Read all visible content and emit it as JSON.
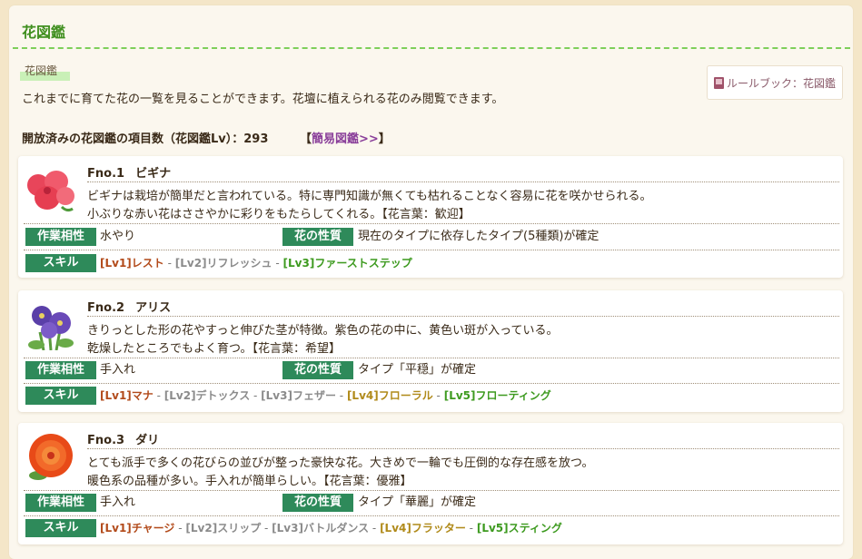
{
  "page": {
    "title": "花図鑑",
    "section_label": "花図鑑",
    "rulebook_label": "ルールブック：花図鑑",
    "description": "これまでに育てた花の一覧を見ることができます。花壇に植えられる花のみ閲覧できます。",
    "count_label": "開放済みの花図鑑の項目数（花図鑑Lv）：293",
    "quick_open": "【",
    "quick_link": "簡易図鑑>>",
    "quick_close": "】"
  },
  "labels": {
    "work": "作業相性",
    "nature": "花の性質",
    "skill": "スキル"
  },
  "flowers": [
    {
      "no": "Fno.1",
      "name": "ビギナ",
      "line1": "ビギナは栽培が簡単だと言われている。特に専門知識が無くても枯れることなく容易に花を咲かせられる。",
      "line2": "小ぶりな赤い花はささやかに彩りをもたらしてくれる。【花言葉：歓迎】",
      "work": "水やり",
      "nature": "現在のタイプに依存したタイプ(5種類)が確定",
      "skills": [
        {
          "text": "[Lv1]レスト",
          "color": "red"
        },
        {
          "text": "[Lv2]リフレッシュ",
          "color": "gray"
        },
        {
          "text": "[Lv3]ファーストステップ",
          "color": "green"
        }
      ]
    },
    {
      "no": "Fno.2",
      "name": "アリス",
      "line1": "きりっとした形の花やすっと伸びた茎が特徴。紫色の花の中に、黄色い斑が入っている。",
      "line2": "乾燥したところでもよく育つ。【花言葉：希望】",
      "work": "手入れ",
      "nature": "タイプ「平穏」が確定",
      "skills": [
        {
          "text": "[Lv1]マナ",
          "color": "red"
        },
        {
          "text": "[Lv2]デトックス",
          "color": "gray"
        },
        {
          "text": "[Lv3]フェザー",
          "color": "gray"
        },
        {
          "text": "[Lv4]フローラル",
          "color": "gold"
        },
        {
          "text": "[Lv5]フローティング",
          "color": "green"
        }
      ]
    },
    {
      "no": "Fno.3",
      "name": "ダリ",
      "line1": "とても派手で多くの花びらの並びが整った豪快な花。大きめで一輪でも圧倒的な存在感を放つ。",
      "line2": "暖色系の品種が多い。手入れが簡単らしい。【花言葉：優雅】",
      "work": "手入れ",
      "nature": "タイプ「華麗」が確定",
      "skills": [
        {
          "text": "[Lv1]チャージ",
          "color": "red"
        },
        {
          "text": "[Lv2]スリップ",
          "color": "gray"
        },
        {
          "text": "[Lv3]バトルダンス",
          "color": "gray"
        },
        {
          "text": "[Lv4]フラッター",
          "color": "gold"
        },
        {
          "text": "[Lv5]スティング",
          "color": "green"
        }
      ]
    }
  ]
}
